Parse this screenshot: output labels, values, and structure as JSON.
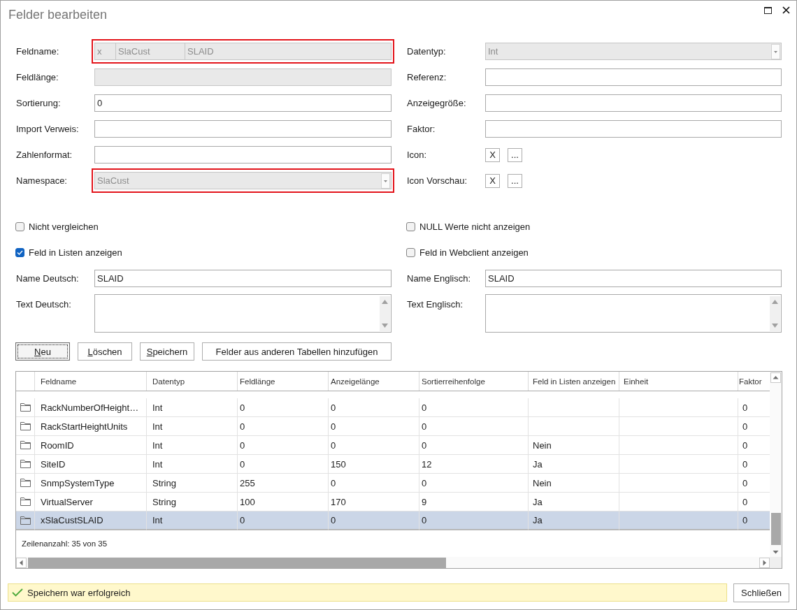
{
  "window": {
    "title": "Felder bearbeiten"
  },
  "left_column": {
    "fields": [
      {
        "kind": "segmented",
        "label": "Feldname:",
        "segments": [
          "x",
          "SlaCust",
          "SLAID"
        ],
        "disabled": true,
        "highlighted": true
      },
      {
        "kind": "text",
        "label": "Feldlänge:",
        "disabled": true,
        "highlighted": false
      },
      {
        "kind": "text",
        "label": "Sortierung:",
        "value": "0",
        "disabled": false,
        "highlighted": false
      },
      {
        "kind": "text",
        "label": "Import Verweis:",
        "disabled": false,
        "highlighted": false
      },
      {
        "kind": "text",
        "label": "Zahlenformat:",
        "disabled": false,
        "highlighted": false
      },
      {
        "kind": "dropdown",
        "label": "Namespace:",
        "value": "SlaCust",
        "disabled": true,
        "highlighted": true
      }
    ],
    "checkboxes": [
      {
        "label": "Nicht vergleichen",
        "checked": false
      },
      {
        "label": "Feld in Listen anzeigen",
        "checked": true
      }
    ],
    "language_fields": [
      {
        "kind": "text",
        "label": "Name Deutsch:",
        "value": "SLAID"
      },
      {
        "kind": "textarea",
        "label": "Text Deutsch:"
      }
    ]
  },
  "right_column": {
    "fields": [
      {
        "kind": "dropdown",
        "label": "Datentyp:",
        "value": "Int",
        "disabled": true,
        "highlighted": false
      },
      {
        "kind": "text",
        "label": "Referenz:",
        "disabled": false,
        "highlighted": false
      },
      {
        "kind": "text",
        "label": "Anzeigegröße:",
        "disabled": false,
        "highlighted": false
      },
      {
        "kind": "text",
        "label": "Faktor:",
        "disabled": false,
        "highlighted": false
      },
      {
        "kind": "icon_buttons",
        "label": "Icon:",
        "buttons": [
          "X",
          "..."
        ],
        "disabled": false,
        "highlighted": false
      },
      {
        "kind": "icon_buttons",
        "label": "Icon Vorschau:",
        "buttons": [
          "X",
          "..."
        ],
        "disabled": false,
        "highlighted": false
      }
    ],
    "checkboxes": [
      {
        "label": "NULL Werte nicht anzeigen",
        "checked": false
      },
      {
        "label": "Feld in Webclient anzeigen",
        "checked": false
      }
    ],
    "language_fields": [
      {
        "kind": "text",
        "label": "Name Englisch:",
        "value": "SLAID"
      },
      {
        "kind": "textarea",
        "label": "Text Englisch:"
      }
    ]
  },
  "actions": [
    {
      "label": "Neu",
      "mnemonic": true,
      "focused": true
    },
    {
      "label": "Löschen",
      "mnemonic": true,
      "focused": false
    },
    {
      "label": "Speichern",
      "mnemonic": true,
      "focused": false
    },
    {
      "label": "Felder aus anderen Tabellen hinzufügen",
      "mnemonic": false,
      "focused": false
    }
  ],
  "table": {
    "columns": [
      "Feldname",
      "Datentyp",
      "Feldlänge",
      "Anzeigelänge",
      "Sortierreihenfolge",
      "Feld in Listen anzeigen",
      "Einheit",
      "Faktor"
    ],
    "rows": [
      {
        "cells": [
          "RackNumberOfHeight…",
          "Int",
          "0",
          "0",
          "0",
          null,
          null,
          "0"
        ],
        "selected": false
      },
      {
        "cells": [
          "RackStartHeightUnits",
          "Int",
          "0",
          "0",
          "0",
          null,
          null,
          "0"
        ],
        "selected": false
      },
      {
        "cells": [
          "RoomID",
          "Int",
          "0",
          "0",
          "0",
          "Nein",
          null,
          "0"
        ],
        "selected": false
      },
      {
        "cells": [
          "SiteID",
          "Int",
          "0",
          "150",
          "12",
          "Ja",
          null,
          "0"
        ],
        "selected": false
      },
      {
        "cells": [
          "SnmpSystemType",
          "String",
          "255",
          "0",
          "0",
          "Nein",
          null,
          "0"
        ],
        "selected": false
      },
      {
        "cells": [
          "VirtualServer",
          "String",
          "100",
          "170",
          "9",
          "Ja",
          null,
          "0"
        ],
        "selected": false
      },
      {
        "cells": [
          "xSlaCustSLAID",
          "Int",
          "0",
          "0",
          "0",
          "Ja",
          null,
          "0"
        ],
        "selected": true
      }
    ],
    "row_count": "Zeilenanzahl: 35 von 35"
  },
  "status_bar": {
    "kind": "success",
    "message": "Speichern war erfolgreich"
  },
  "close_button": {
    "label": "Schließen"
  }
}
